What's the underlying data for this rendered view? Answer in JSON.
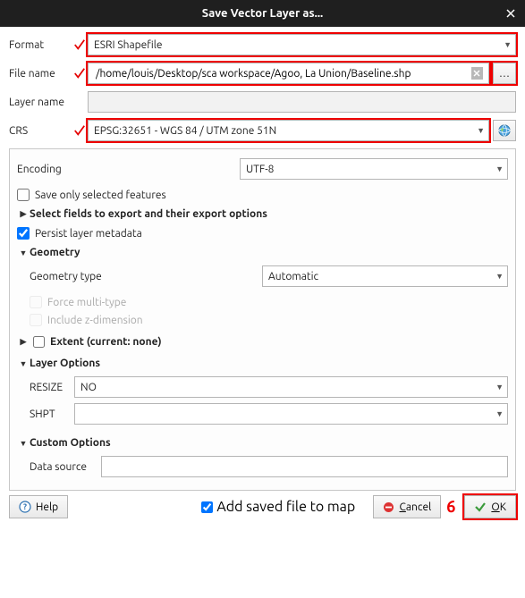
{
  "window": {
    "title": "Save Vector Layer as..."
  },
  "form": {
    "format_label": "Format",
    "format_value": "ESRI Shapefile",
    "filename_label": "File name",
    "filename_value": "/home/louis/Desktop/sca workspace/Agoo, La Union/Baseline.shp",
    "filename_browse": "…",
    "layername_label": "Layer name",
    "layername_value": "",
    "crs_label": "CRS",
    "crs_value": "EPSG:32651 - WGS 84 / UTM zone 51N"
  },
  "encoding": {
    "label": "Encoding",
    "value": "UTF-8"
  },
  "options": {
    "save_selected": "Save only selected features",
    "select_fields": "Select fields to export and their export options",
    "persist_metadata": "Persist layer metadata"
  },
  "geometry": {
    "header": "Geometry",
    "type_label": "Geometry type",
    "type_value": "Automatic",
    "force_multi": "Force multi-type",
    "include_z": "Include z-dimension"
  },
  "extent": {
    "label": "Extent (current: none)"
  },
  "layer_options": {
    "header": "Layer Options",
    "resize_label": "RESIZE",
    "resize_value": "NO",
    "shpt_label": "SHPT",
    "shpt_value": ""
  },
  "custom": {
    "header": "Custom Options",
    "data_source_label": "Data source",
    "data_source_value": ""
  },
  "footer": {
    "help": "Help",
    "add_to_map": "Add saved file to map",
    "cancel": "Cancel",
    "ok": "OK"
  },
  "annotation": {
    "step": "6"
  }
}
